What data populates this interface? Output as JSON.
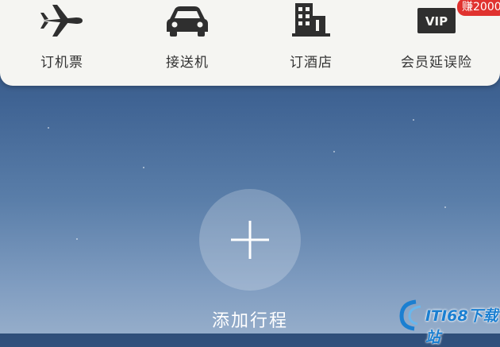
{
  "services": [
    {
      "label": "订机票",
      "icon": "airplane-icon"
    },
    {
      "label": "接送机",
      "icon": "car-icon"
    },
    {
      "label": "订酒店",
      "icon": "hotel-building-icon"
    },
    {
      "label": "会员延误险",
      "icon": "vip-card-icon",
      "badge": "赚2000"
    }
  ],
  "add_trip": {
    "label": "添加行程",
    "icon": "plus-icon"
  },
  "watermark": {
    "text": "ITI68下载站"
  },
  "colors": {
    "badge": "#e0322f",
    "panel": "#f5f5f2",
    "sky_top": "#2f4e79",
    "sky_bottom": "#95adca"
  }
}
